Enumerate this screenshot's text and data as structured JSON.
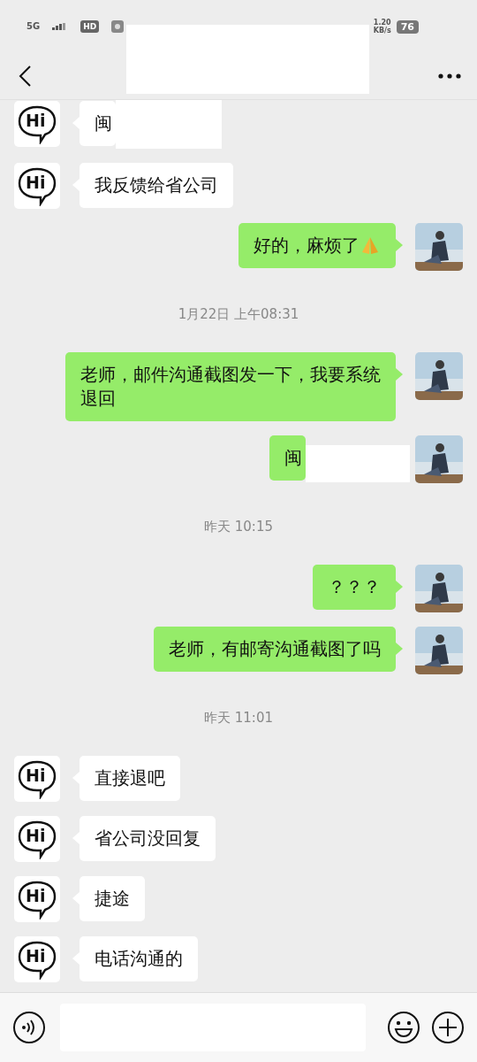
{
  "status_bar": {
    "network": "5G",
    "hd": "HD",
    "speed": "1.20",
    "speed_unit": "KB/s",
    "battery": "76"
  },
  "header": {
    "title_redacted": true
  },
  "messages": [
    {
      "kind": "in",
      "avatar_label": "Hi",
      "text": "闽",
      "redacted": true
    },
    {
      "kind": "in",
      "avatar_label": "Hi",
      "text": "我反馈给省公司",
      "redacted": false
    },
    {
      "kind": "out",
      "text": "好的，麻烦了",
      "redacted": false,
      "emoji": true
    },
    {
      "kind": "time",
      "text": "1月22日 上午08:31"
    },
    {
      "kind": "out",
      "text": "老师，邮件沟通截图发一下，我要系统退回",
      "redacted": false
    },
    {
      "kind": "out",
      "text": "闽",
      "redacted": true
    },
    {
      "kind": "time",
      "text": "昨天 10:15"
    },
    {
      "kind": "out",
      "text": "？？？",
      "redacted": false
    },
    {
      "kind": "out",
      "text": "老师，有邮寄沟通截图了吗",
      "redacted": false
    },
    {
      "kind": "time",
      "text": "昨天 11:01"
    },
    {
      "kind": "in",
      "avatar_label": "Hi",
      "text": "直接退吧",
      "redacted": false
    },
    {
      "kind": "in",
      "avatar_label": "Hi",
      "text": "省公司没回复",
      "redacted": false
    },
    {
      "kind": "in",
      "avatar_label": "Hi",
      "text": "捷途",
      "redacted": false
    },
    {
      "kind": "in",
      "avatar_label": "Hi",
      "text": "电话沟通的",
      "redacted": false
    }
  ]
}
